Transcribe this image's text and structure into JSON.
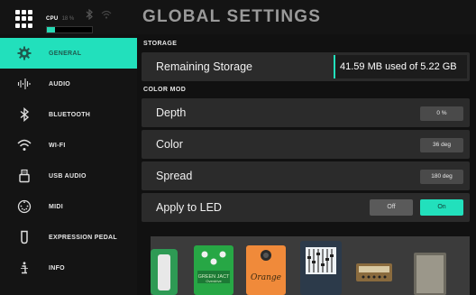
{
  "header": {
    "title": "GLOBAL SETTINGS",
    "menu_icon": "grid-menu-icon",
    "cpu_label": "CPU",
    "cpu_percent_text": "18 %",
    "cpu_load_fraction": 0.18,
    "bluetooth_icon": "bluetooth-icon",
    "wifi_icon": "wifi-icon"
  },
  "sidebar": {
    "items": [
      {
        "label": "GENERAL",
        "icon": "gear-icon",
        "active": true
      },
      {
        "label": "AUDIO",
        "icon": "waveform-icon",
        "active": false
      },
      {
        "label": "BLUETOOTH",
        "icon": "bluetooth-icon",
        "active": false
      },
      {
        "label": "WI-FI",
        "icon": "wifi-icon",
        "active": false
      },
      {
        "label": "USB AUDIO",
        "icon": "usb-icon",
        "active": false
      },
      {
        "label": "MIDI",
        "icon": "midi-icon",
        "active": false
      },
      {
        "label": "EXPRESSION PEDAL",
        "icon": "expression-pedal-icon",
        "active": false
      },
      {
        "label": "INFO",
        "icon": "info-icon",
        "active": false
      }
    ]
  },
  "storage": {
    "header": "STORAGE",
    "label": "Remaining Storage",
    "value": "41.59 MB used of 5.22 GB"
  },
  "color_mod": {
    "header": "COLOR MOD",
    "depth": {
      "label": "Depth",
      "value": "0 %"
    },
    "color": {
      "label": "Color",
      "value": "36 deg"
    },
    "spread": {
      "label": "Spread",
      "value": "180 deg"
    },
    "apply_led": {
      "label": "Apply to LED",
      "off_label": "Off",
      "on_label": "On",
      "state": "on"
    }
  },
  "pedal_labels": {
    "green_jacket": "GREEN JACT",
    "green_jacket_sub": "Overdrive",
    "orange": "Orange"
  },
  "colors": {
    "accent": "#22e0bc",
    "background": "#111111",
    "row_bg": "#2b2b2b"
  }
}
